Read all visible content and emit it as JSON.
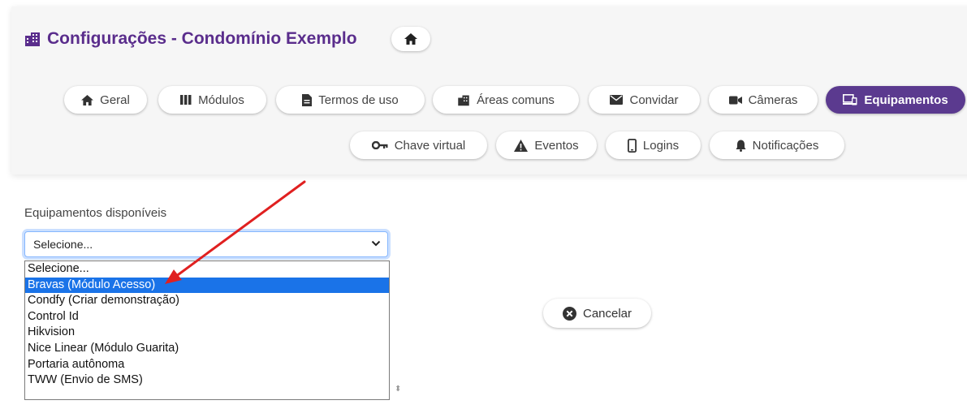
{
  "header": {
    "title": "Configurações - Condomínio Exemplo"
  },
  "tabs_row1": [
    {
      "label": "Geral",
      "icon": "home-icon"
    },
    {
      "label": "Módulos",
      "icon": "columns-icon"
    },
    {
      "label": "Termos de uso",
      "icon": "file-icon"
    },
    {
      "label": "Áreas comuns",
      "icon": "building-icon"
    },
    {
      "label": "Convidar",
      "icon": "envelope-icon"
    },
    {
      "label": "Câmeras",
      "icon": "video-icon"
    },
    {
      "label": "Equipamentos",
      "icon": "devices-icon",
      "active": true
    }
  ],
  "tabs_row2": [
    {
      "label": "Chave virtual",
      "icon": "key-icon"
    },
    {
      "label": "Eventos",
      "icon": "warning-icon"
    },
    {
      "label": "Logins",
      "icon": "mobile-icon"
    },
    {
      "label": "Notificações",
      "icon": "bell-icon"
    }
  ],
  "equipment": {
    "label": "Equipamentos disponíveis",
    "selected": "Selecione...",
    "options": [
      "Selecione...",
      "Bravas (Módulo Acesso)",
      "Condfy (Criar demonstração)",
      "Control Id",
      "Hikvision",
      "Nice Linear (Módulo Guarita)",
      "Portaria autônoma",
      "TWW (Envio de SMS)"
    ],
    "highlighted_index": 1
  },
  "actions": {
    "cancel_label": "Cancelar"
  },
  "colors": {
    "title": "#5a2d8c",
    "active_tab": "#5b3a8f",
    "highlight": "#1a73e8",
    "arrow": "#e02020"
  }
}
